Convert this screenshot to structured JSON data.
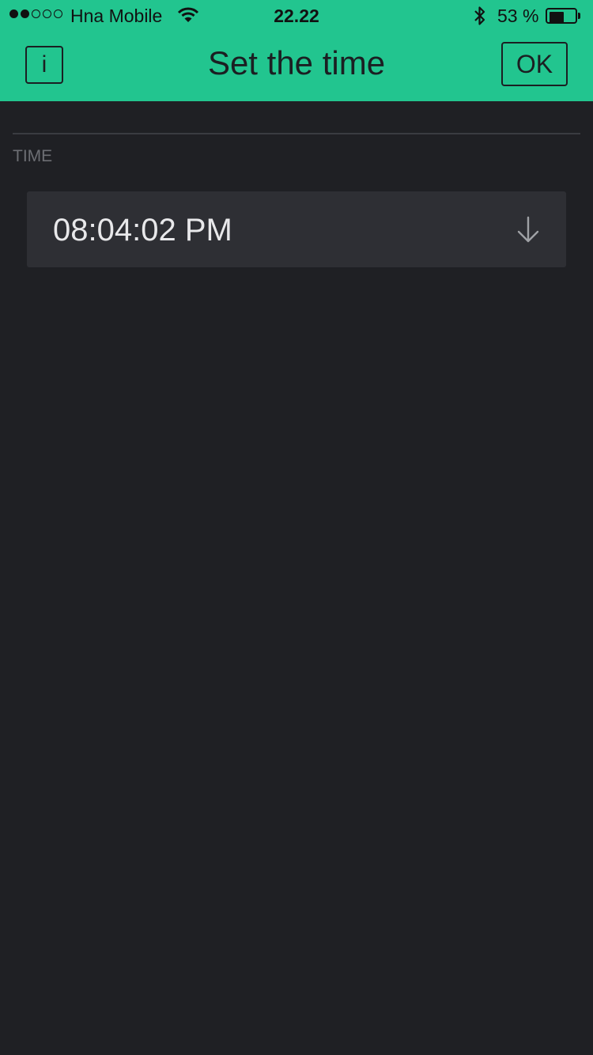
{
  "status_bar": {
    "signal_dots_filled": 2,
    "signal_dots_total": 5,
    "carrier": "Hna Mobile",
    "wifi_icon": "wifi-icon",
    "time": "22.22",
    "bluetooth_icon": "bluetooth-icon",
    "battery_percent_label": "53 %",
    "battery_level": 0.53
  },
  "header": {
    "title": "Set the time",
    "info_label": "i",
    "ok_label": "OK",
    "color": "#22c58f"
  },
  "section": {
    "label": "TIME"
  },
  "time_picker": {
    "value": "08:04:02 PM",
    "icon": "arrow-down-icon"
  },
  "colors": {
    "background": "#1f2024",
    "field": "#2e2f34",
    "accent": "#22c58f"
  }
}
